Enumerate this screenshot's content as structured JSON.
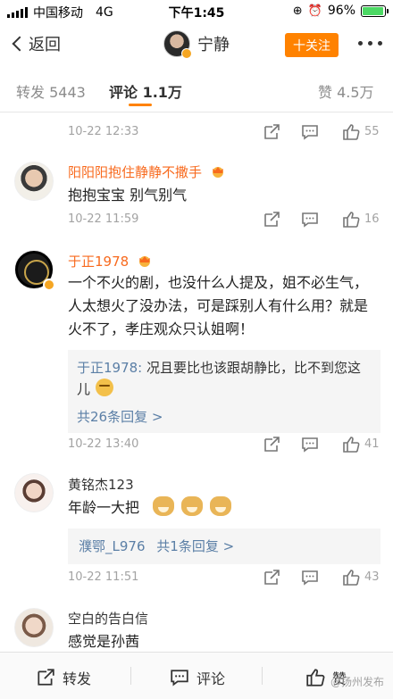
{
  "status_bar": {
    "carrier": "中国移动",
    "network": "4G",
    "time": "下午1:45",
    "battery": "96%",
    "battery_level": 0.96
  },
  "nav": {
    "back_label": "返回",
    "title": "宁静",
    "follow_label": "十关注"
  },
  "tabs": [
    {
      "label": "转发 5443"
    },
    {
      "label": "评论 1.1万"
    },
    {
      "label": "赞 4.5万"
    }
  ],
  "comments": [
    {
      "time": "10-22 12:33",
      "likes": "55"
    },
    {
      "name": "阳阳阳抱住静静不撒手",
      "text": "抱抱宝宝 别气别气",
      "time": "10-22 11:59",
      "likes": "16"
    },
    {
      "name": "于正1978",
      "text": "一个不火的剧，也没什么人提及，姐不必生气，人太想火了没办法，可是踩别人有什么用？就是火不了，孝庄观众只认姐啊！",
      "reply_name": "于正1978:",
      "reply_text": " 况且要比也该跟胡静比，比不到您这儿",
      "reply_more": "共26条回复 >",
      "time": "10-22 13:40",
      "likes": "41"
    },
    {
      "name": "黄铭杰123",
      "text": "年龄一大把",
      "reply_name": "濮鄂_L976",
      "reply_more": "共1条回复 >",
      "time": "10-22 11:51",
      "likes": "43"
    },
    {
      "name": "空白的告白信",
      "text": "感觉是孙茜"
    }
  ],
  "bottom_bar": {
    "repost_label": "转发",
    "comment_label": "评论",
    "like_label": "赞",
    "watermark": "@扬州发布"
  },
  "colors": {
    "accent": "#ff8200",
    "vip_name": "#f86a1e",
    "link": "#5b7fa6"
  }
}
